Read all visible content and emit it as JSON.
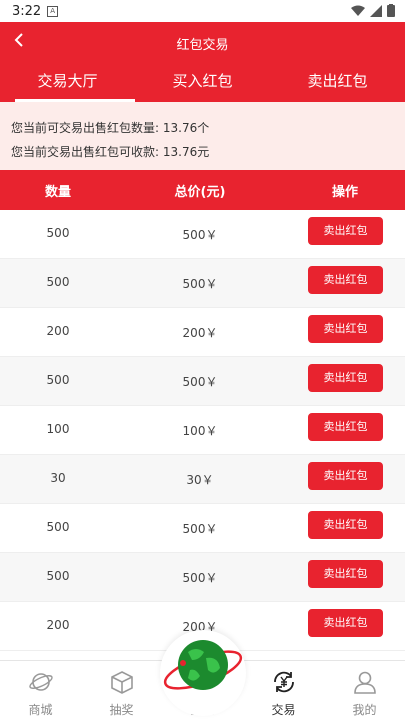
{
  "status": {
    "time": "3:22"
  },
  "header": {
    "title": "红包交易"
  },
  "tabs": [
    "交易大厅",
    "买入红包",
    "卖出红包"
  ],
  "notice": {
    "line1": "您当前可交易出售红包数量: 13.76个",
    "line2": "您当前交易出售红包可收款: 13.76元"
  },
  "table": {
    "headers": [
      "数量",
      "总价(元)",
      "操作"
    ],
    "rows": [
      {
        "qty": "500",
        "price": "500￥",
        "action": "卖出红包"
      },
      {
        "qty": "500",
        "price": "500￥",
        "action": "卖出红包"
      },
      {
        "qty": "200",
        "price": "200￥",
        "action": "卖出红包"
      },
      {
        "qty": "500",
        "price": "500￥",
        "action": "卖出红包"
      },
      {
        "qty": "100",
        "price": "100￥",
        "action": "卖出红包"
      },
      {
        "qty": "30",
        "price": "30￥",
        "action": "卖出红包"
      },
      {
        "qty": "500",
        "price": "500￥",
        "action": "卖出红包"
      },
      {
        "qty": "500",
        "price": "500￥",
        "action": "卖出红包"
      },
      {
        "qty": "200",
        "price": "200￥",
        "action": "卖出红包"
      }
    ]
  },
  "bottom_nav": [
    {
      "label": "商城",
      "icon": "planet-icon"
    },
    {
      "label": "抽奖",
      "icon": "box-icon"
    },
    {
      "label": "生态",
      "icon": "globe-icon"
    },
    {
      "label": "交易",
      "icon": "yen-exchange-icon"
    },
    {
      "label": "我的",
      "icon": "user-icon"
    }
  ]
}
